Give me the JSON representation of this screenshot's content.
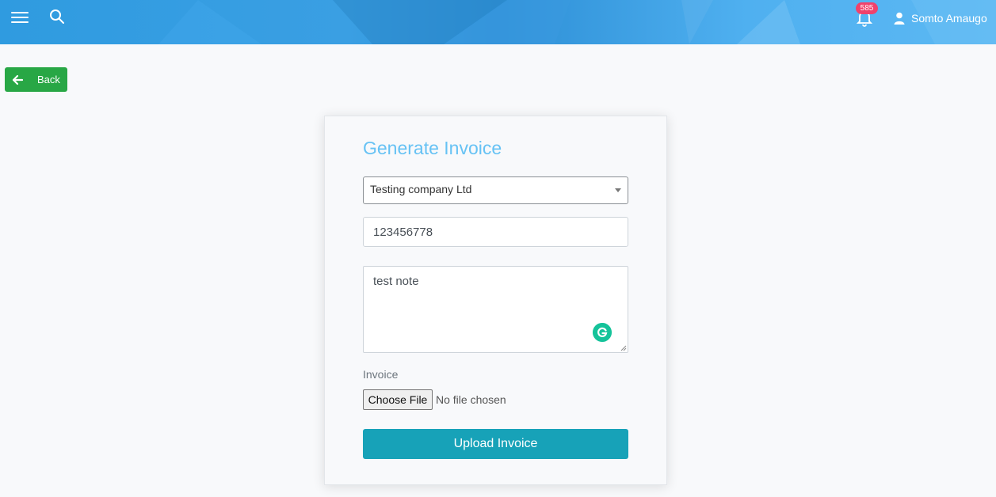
{
  "header": {
    "notification_count": "585",
    "user_name": "Somto Amaugo",
    "icons": [
      "hamburger-menu-icon",
      "search-icon",
      "bell-icon",
      "user-icon"
    ]
  },
  "back": {
    "label": "Back"
  },
  "form": {
    "title": "Generate Invoice",
    "company_select": {
      "value": "Testing company Ltd"
    },
    "number_input": {
      "value": "123456778"
    },
    "note_textarea": {
      "value": "test note"
    },
    "file": {
      "label": "Invoice",
      "button_label": "Choose File",
      "status": "No file chosen"
    },
    "submit_label": "Upload Invoice"
  },
  "colors": {
    "topbar": "#2f9be0",
    "title": "#66c2f4",
    "back_button": "#28a745",
    "upload_button": "#17a2b8",
    "badge": "#f0426c",
    "grammarly": "#15c39a"
  }
}
